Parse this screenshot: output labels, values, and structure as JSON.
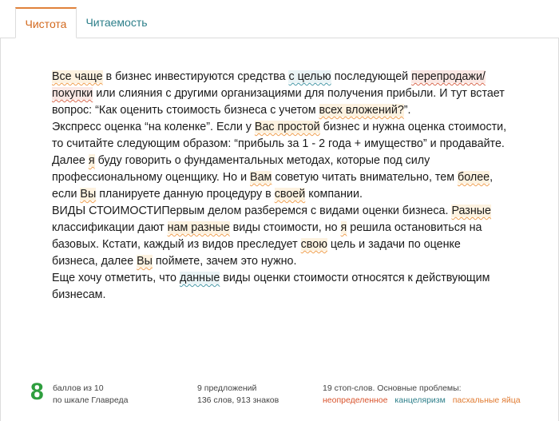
{
  "tabs": [
    {
      "label": "Чистота",
      "active": true
    },
    {
      "label": "Читаемость",
      "active": false
    }
  ],
  "paragraphs": [
    [
      {
        "t": "Все чаще",
        "h": "orange"
      },
      {
        "t": " в бизнес инвестируются средства "
      },
      {
        "t": "с целью",
        "h": "teal"
      },
      {
        "t": " последующей "
      },
      {
        "t": "перепродажи/покупки",
        "h": "red"
      },
      {
        "t": " или слияния с другими организациями для получения прибыли. И тут встает вопрос: “Как оценить стоимость бизнеса с учетом "
      },
      {
        "t": "всех вложений?",
        "h": "orange"
      },
      {
        "t": "”."
      }
    ],
    [
      {
        "t": "Экспресс оценка “на коленке”. Если у "
      },
      {
        "t": "Вас простой",
        "h": "orange"
      },
      {
        "t": " бизнес и нужна оценка стоимости, то считайте следующим образом: “прибыль за 1 - 2 года + имущество” и продавайте."
      }
    ],
    [
      {
        "t": "Далее "
      },
      {
        "t": "я",
        "h": "orange"
      },
      {
        "t": " буду говорить о фундаментальных методах, которые под силу профессиональному оценщику. Но и "
      },
      {
        "t": "Вам",
        "h": "orange"
      },
      {
        "t": " советую читать внимательно, тем "
      },
      {
        "t": "более",
        "h": "orange"
      },
      {
        "t": ", если "
      },
      {
        "t": "Вы",
        "h": "orange"
      },
      {
        "t": " планируете данную процедуру в "
      },
      {
        "t": "своей",
        "h": "orange"
      },
      {
        "t": " компании."
      }
    ],
    [
      {
        "t": "ВИДЫ СТОИМОСТИПервым делом разберемся с видами оценки бизнеса. "
      },
      {
        "t": "Разные",
        "h": "orange"
      },
      {
        "t": " классификации дают "
      },
      {
        "t": "нам разные",
        "h": "orange"
      },
      {
        "t": " виды стоимости, но "
      },
      {
        "t": "я",
        "h": "orange"
      },
      {
        "t": " решила остановиться на базовых. Кстати, каждый из видов преследует "
      },
      {
        "t": "свою",
        "h": "orange"
      },
      {
        "t": " цель и задачи по оценке бизнеса, далее "
      },
      {
        "t": "Вы",
        "h": "orange"
      },
      {
        "t": " поймете, зачем это нужно."
      }
    ],
    [
      {
        "t": "Еще хочу отметить, что "
      },
      {
        "t": "данные",
        "h": "teal"
      },
      {
        "t": " виды оценки стоимости относятся к действующим бизнесам."
      }
    ]
  ],
  "footer": {
    "score": "8",
    "score_line1": "баллов из 10",
    "score_line2": "по шкале Главреда",
    "stats_line1": "9 предложений",
    "stats_line2": "136 слов, 913 знаков",
    "problems_line1": "19 стоп-слов. Основные проблемы:",
    "tag_indefinite": "неопределенное",
    "tag_officialese": "канцеляризм",
    "tag_easter": "пасхальные яйца"
  },
  "colors": {
    "accent_orange": "#e0823a",
    "teal": "#2d7f8a",
    "score_green": "#2e9e3e",
    "tag_red": "#d9532c"
  }
}
